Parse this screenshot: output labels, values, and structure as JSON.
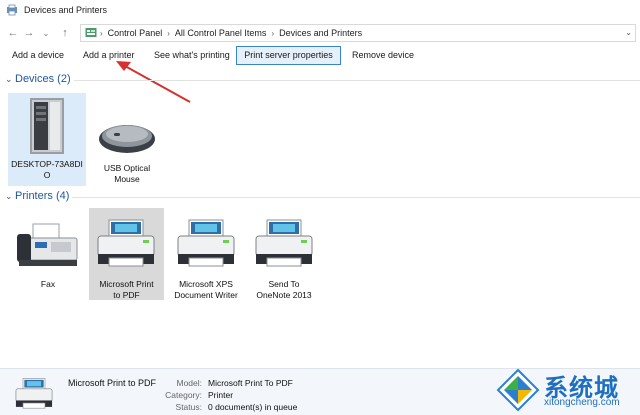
{
  "window": {
    "title": "Devices and Printers"
  },
  "breadcrumb": {
    "items": [
      "Control Panel",
      "All Control Panel Items",
      "Devices and Printers"
    ]
  },
  "toolbar": {
    "buttons": [
      "Add a device",
      "Add a printer",
      "See what's printing",
      "Print server properties",
      "Remove device"
    ]
  },
  "groups": {
    "devices": {
      "title": "Devices (2)",
      "items": [
        {
          "label_line1": "DESKTOP-73A8DI",
          "label_line2": "O",
          "icon": "computer-tower-icon"
        },
        {
          "label_line1": "USB Optical",
          "label_line2": "Mouse",
          "icon": "mouse-icon"
        }
      ]
    },
    "printers": {
      "title": "Printers (4)",
      "items": [
        {
          "label_line1": "Fax",
          "label_line2": "",
          "icon": "fax-icon"
        },
        {
          "label_line1": "Microsoft Print",
          "label_line2": "to PDF",
          "icon": "printer-icon"
        },
        {
          "label_line1": "Microsoft XPS",
          "label_line2": "Document Writer",
          "icon": "printer-icon"
        },
        {
          "label_line1": "Send To",
          "label_line2": "OneNote 2013",
          "icon": "printer-icon"
        }
      ]
    }
  },
  "details": {
    "name": "Microsoft Print to PDF",
    "fields": [
      {
        "key": "Model:",
        "value": "Microsoft Print To PDF"
      },
      {
        "key": "Category:",
        "value": "Printer"
      },
      {
        "key": "Status:",
        "value": "0 document(s) in queue"
      }
    ]
  },
  "watermark": {
    "chinese": "系统城",
    "pinyin": "xitongcheng.com"
  },
  "colors": {
    "accent": "#1e5799",
    "selection": "#dcebf9",
    "annotation_arrow": "#d8302a"
  }
}
